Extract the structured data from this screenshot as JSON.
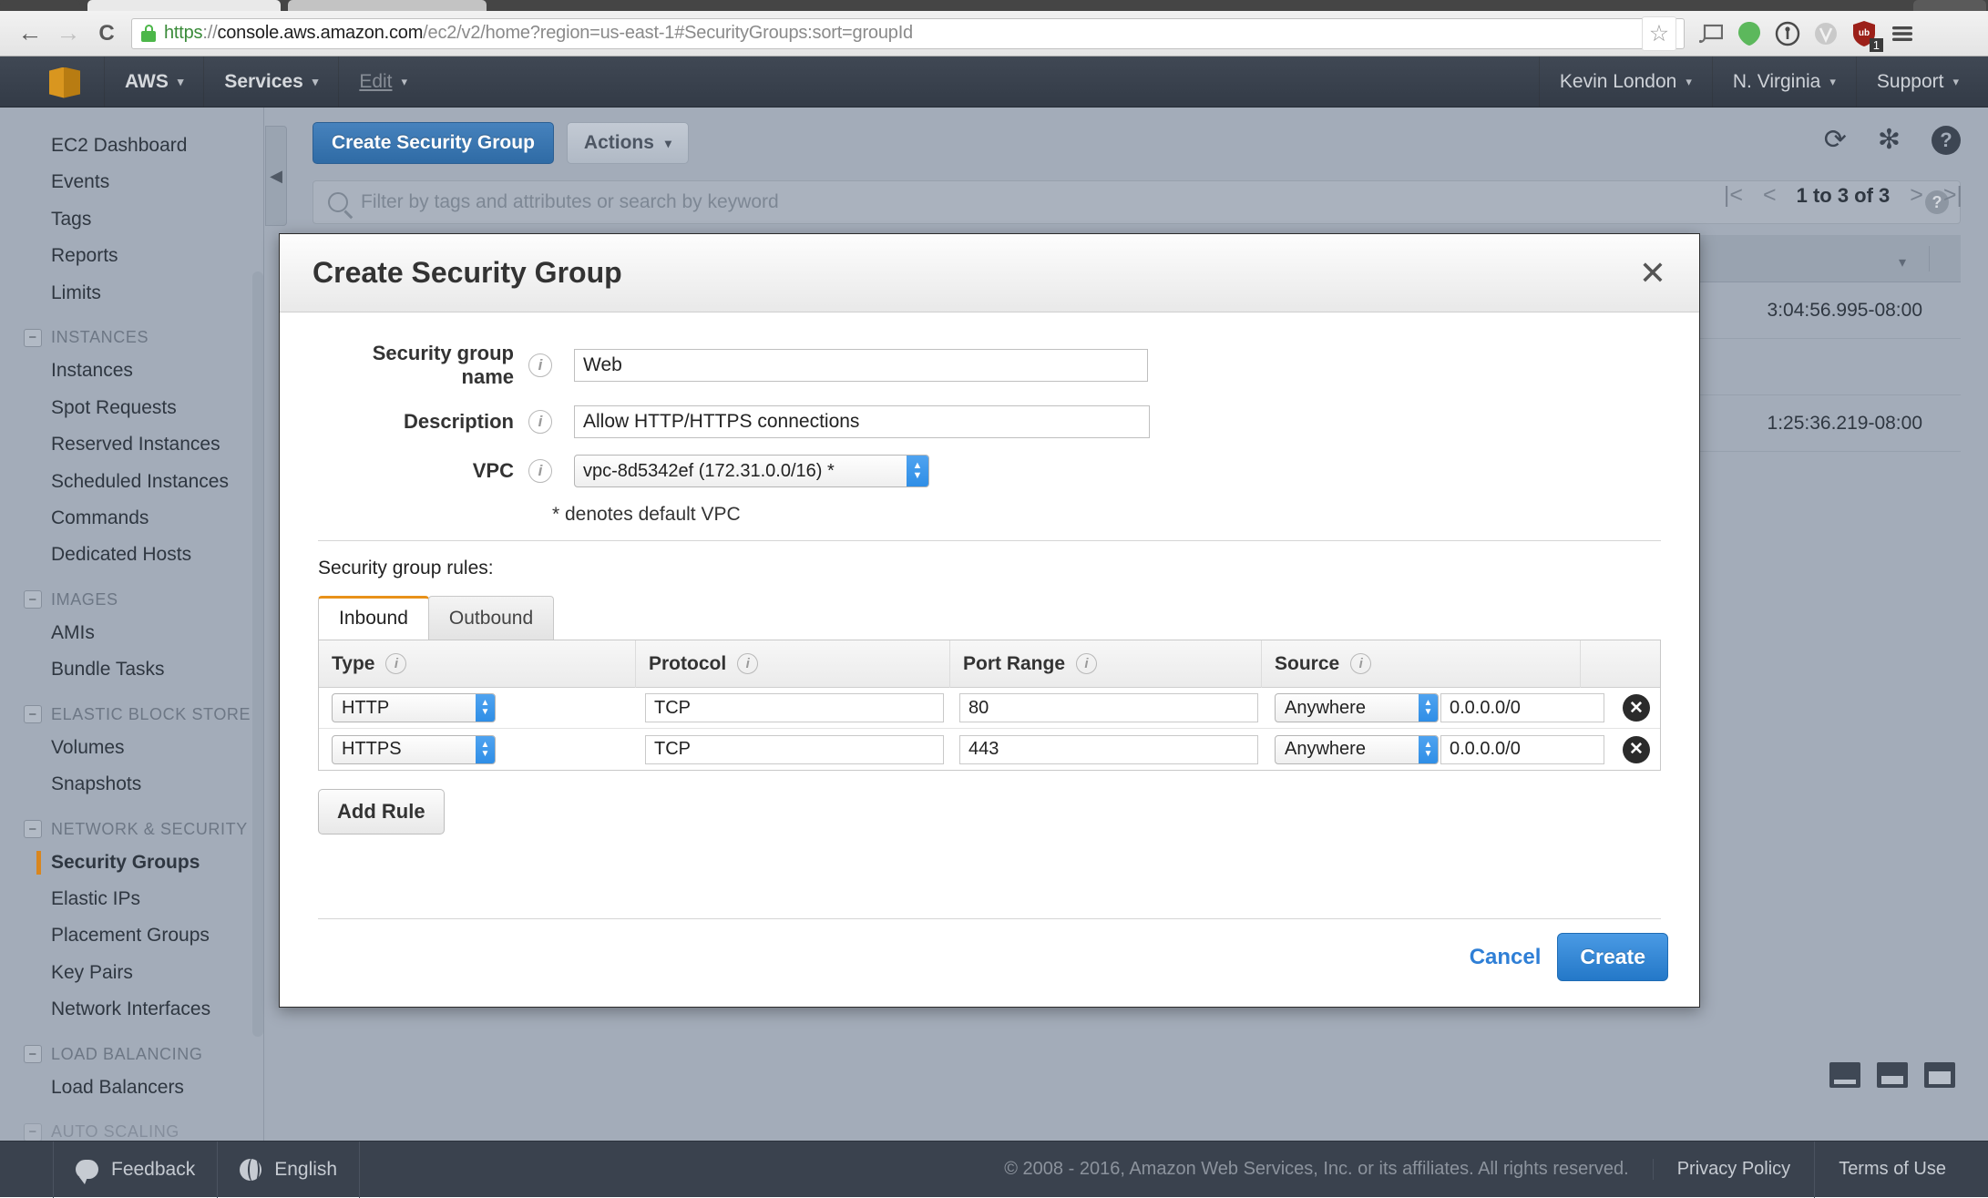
{
  "browser": {
    "back_icon": "←",
    "forward_icon": "→",
    "reload_icon": "C",
    "lock_icon": "lock-icon",
    "url": {
      "scheme": "https",
      "sep": "://",
      "host": "console.aws.amazon.com",
      "path": "/ec2/v2/home?region=us-east-1#SecurityGroups:sort=groupId"
    },
    "star_icon": "☆",
    "extensions": [
      {
        "name": "cast-icon",
        "glyph": "▭"
      },
      {
        "name": "evernote-icon",
        "glyph": "●"
      },
      {
        "name": "onepassword-icon",
        "glyph": "①"
      },
      {
        "name": "vimium-icon",
        "glyph": "V"
      },
      {
        "name": "ublock-icon",
        "glyph": "ub",
        "badge": "1"
      },
      {
        "name": "chrome-menu-icon",
        "glyph": "≡"
      }
    ]
  },
  "aws_nav": {
    "logo": "aws-cube-logo",
    "left_items": [
      {
        "label": "AWS",
        "caret": "▾"
      },
      {
        "label": "Services",
        "caret": "▾"
      },
      {
        "label": "Edit",
        "caret": "▾"
      }
    ],
    "right_items": [
      {
        "label": "Kevin London",
        "caret": "▾"
      },
      {
        "label": "N. Virginia",
        "caret": "▾"
      },
      {
        "label": "Support",
        "caret": "▾"
      }
    ]
  },
  "sidebar": {
    "top_links": [
      "EC2 Dashboard",
      "Events",
      "Tags",
      "Reports",
      "Limits"
    ],
    "sections": [
      {
        "title": "INSTANCES",
        "collapse_glyph": "−",
        "links": [
          "Instances",
          "Spot Requests",
          "Reserved Instances",
          "Scheduled Instances",
          "Commands",
          "Dedicated Hosts"
        ]
      },
      {
        "title": "IMAGES",
        "collapse_glyph": "−",
        "links": [
          "AMIs",
          "Bundle Tasks"
        ]
      },
      {
        "title": "ELASTIC BLOCK STORE",
        "collapse_glyph": "−",
        "links": [
          "Volumes",
          "Snapshots"
        ]
      },
      {
        "title": "NETWORK & SECURITY",
        "collapse_glyph": "−",
        "links": [
          "Security Groups",
          "Elastic IPs",
          "Placement Groups",
          "Key Pairs",
          "Network Interfaces"
        ],
        "active": "Security Groups"
      },
      {
        "title": "LOAD BALANCING",
        "collapse_glyph": "−",
        "links": [
          "Load Balancers"
        ]
      },
      {
        "title": "AUTO SCALING",
        "collapse_glyph": "−",
        "links": []
      }
    ]
  },
  "toolbar": {
    "create_label": "Create Security Group",
    "actions_label": "Actions",
    "actions_caret": "▾",
    "collapse_glyph": "◀",
    "refresh_icon": "⟳",
    "settings_icon": "✻",
    "help_icon": "?"
  },
  "filter": {
    "placeholder": "Filter by tags and attributes or search by keyword",
    "search_icon": "search-icon",
    "help_icon": "?"
  },
  "pager": {
    "first_icon": "|<",
    "prev_icon": "<",
    "label": "1 to 3 of 3",
    "next_icon": ">",
    "last_icon": ">|"
  },
  "background_table": {
    "header_caret": "▾",
    "rows": [
      {
        "timestamp": "3:04:56.995-08:00"
      },
      {
        "timestamp": ""
      },
      {
        "timestamp": "1:25:36.219-08:00"
      }
    ]
  },
  "modal": {
    "title": "Create Security Group",
    "close_icon": "✕",
    "fields": [
      {
        "label": "Security group name",
        "info_icon": "i",
        "value": "Web"
      },
      {
        "label": "Description",
        "info_icon": "i",
        "value": "Allow HTTP/HTTPS connections"
      },
      {
        "label": "VPC",
        "info_icon": "i",
        "value": "vpc-8d5342ef (172.31.0.0/16) *"
      }
    ],
    "vpc_note": "* denotes default VPC",
    "rules_label": "Security group rules:",
    "tabs": [
      {
        "label": "Inbound",
        "active": true
      },
      {
        "label": "Outbound",
        "active": false
      }
    ],
    "columns": [
      {
        "label": "Type",
        "info_icon": "i"
      },
      {
        "label": "Protocol",
        "info_icon": "i"
      },
      {
        "label": "Port Range",
        "info_icon": "i"
      },
      {
        "label": "Source",
        "info_icon": "i"
      }
    ],
    "rules": [
      {
        "type": "HTTP",
        "protocol": "TCP",
        "port": "80",
        "source_type": "Anywhere",
        "source_value": "0.0.0.0/0",
        "delete_icon": "✕"
      },
      {
        "type": "HTTPS",
        "protocol": "TCP",
        "port": "443",
        "source_type": "Anywhere",
        "source_value": "0.0.0.0/0",
        "delete_icon": "✕"
      }
    ],
    "add_rule_label": "Add Rule",
    "cancel_label": "Cancel",
    "create_label": "Create"
  },
  "footer": {
    "feedback_label": "Feedback",
    "language_label": "English",
    "copyright": "© 2008 - 2016, Amazon Web Services, Inc. or its affiliates. All rights reserved.",
    "links": [
      "Privacy Policy",
      "Terms of Use"
    ]
  }
}
